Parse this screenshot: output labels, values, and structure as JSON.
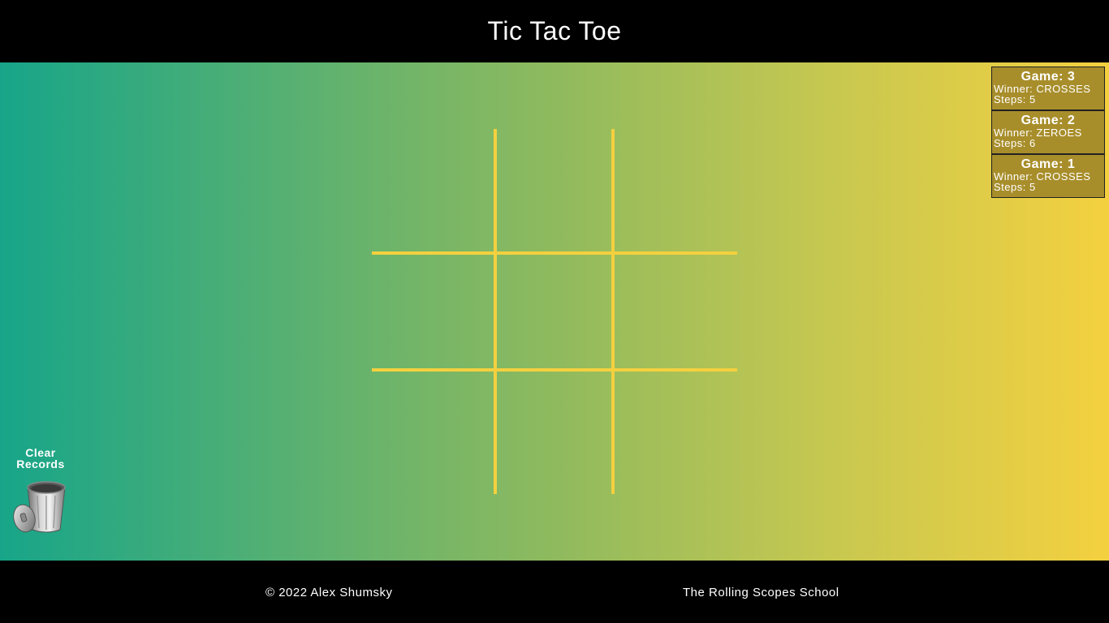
{
  "header": {
    "title": "Tic Tac Toe"
  },
  "board": {
    "cells": [
      "",
      "",
      "",
      "",
      "",
      "",
      "",
      "",
      ""
    ],
    "line_color": "#f4d03f"
  },
  "records": {
    "games": [
      {
        "game": "Game: 3",
        "winner": "Winner: CROSSES",
        "steps": "Steps: 5"
      },
      {
        "game": "Game: 2",
        "winner": "Winner: ZEROES",
        "steps": "Steps: 6"
      },
      {
        "game": "Game: 1",
        "winner": "Winner: CROSSES",
        "steps": "Steps: 5"
      }
    ]
  },
  "clear_records": {
    "label_line1": "Clear",
    "label_line2": "Records",
    "icon": "trash-can-icon"
  },
  "footer": {
    "copyright": "© 2022 Alex Shumsky",
    "school": "The Rolling Scopes School"
  },
  "colors": {
    "gradient_start": "#17a589",
    "gradient_end": "#f4d03f",
    "record_bg": "#a88e2b"
  }
}
